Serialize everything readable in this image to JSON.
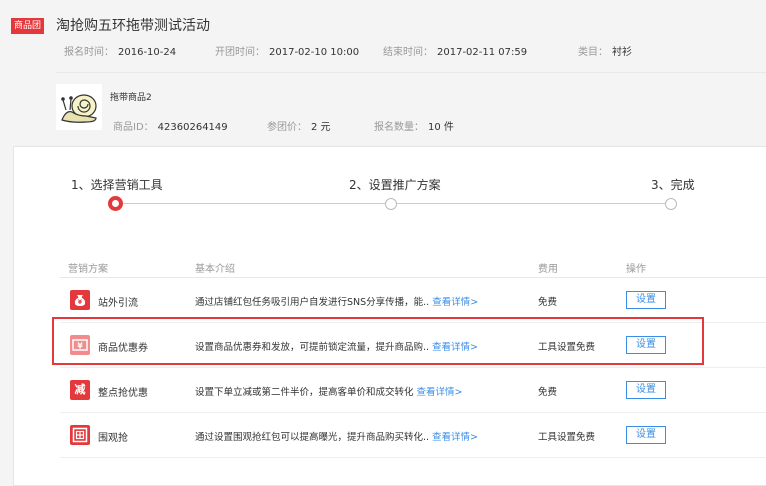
{
  "activity": {
    "tag": "商品团",
    "title": "淘抢购五环拖带测试活动",
    "signup_time_label": "报名时间：",
    "signup_time": "2016-10-24",
    "start_time_label": "开团时间：",
    "start_time": "2017-02-10 10:00",
    "end_time_label": "结束时间：",
    "end_time": "2017-02-11 07:59",
    "category_label": "类目：",
    "category": "衬衫"
  },
  "product": {
    "name": "拖带商品2",
    "id_label": "商品ID：",
    "id": "42360264149",
    "price_label": "参团价：",
    "price": "2 元",
    "qty_label": "报名数量：",
    "qty": "10 件"
  },
  "steps": [
    {
      "label": "1、选择营销工具",
      "state": "active"
    },
    {
      "label": "2、设置推广方案",
      "state": "todo"
    },
    {
      "label": "3、完成",
      "state": "todo"
    }
  ],
  "table": {
    "headers": {
      "plan": "营销方案",
      "intro": "基本介绍",
      "fee": "费用",
      "action": "操作"
    },
    "rows": [
      {
        "icon": "money-bag-icon",
        "icon_char": "💰",
        "icon_color": "#e4393c",
        "name": "站外引流",
        "desc": "通过店铺红包任务吸引用户自发进行SNS分享传播，能..",
        "link": "查看详情>",
        "fee": "免费",
        "button": "设置"
      },
      {
        "icon": "coupon-icon",
        "icon_char": "¥",
        "icon_color": "#f28b8b",
        "name": "商品优惠券",
        "desc": "设置商品优惠券和发放，可提前锁定流量，提升商品购..",
        "link": "查看详情>",
        "fee": "工具设置免费",
        "button": "设置"
      },
      {
        "icon": "discount-icon",
        "icon_char": "减",
        "icon_color": "#e4393c",
        "name": "整点抢优惠",
        "desc": "设置下单立减或第二件半价，提高客单价和成交转化",
        "link": "查看详情>",
        "fee": "免费",
        "button": "设置"
      },
      {
        "icon": "red-packet-icon",
        "icon_char": "囲",
        "icon_color": "#e4393c",
        "name": "围观抢",
        "desc": "通过设置围观抢红包可以提高曝光，提升商品购买转化..",
        "link": "查看详情>",
        "fee": "工具设置免费",
        "button": "设置"
      }
    ]
  },
  "colors": {
    "accent": "#e4393c",
    "link": "#3a8ee6"
  }
}
